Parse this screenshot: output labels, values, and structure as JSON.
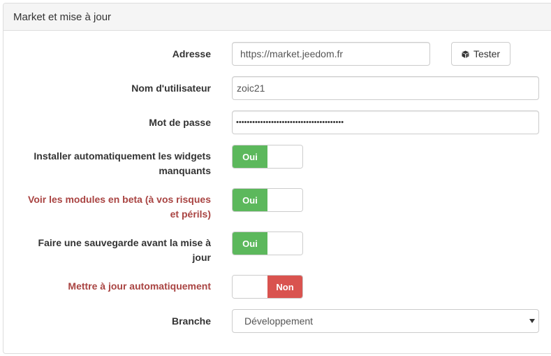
{
  "panel": {
    "title": "Market et mise à jour"
  },
  "fields": {
    "address": {
      "label": "Adresse",
      "value": "https://market.jeedom.fr"
    },
    "test_button": {
      "label": "Tester",
      "icon": "cube-icon"
    },
    "username": {
      "label": "Nom d'utilisateur",
      "value": "zoic21"
    },
    "password": {
      "label": "Mot de passe",
      "value": "••••••••••••••••••••••••••••••••••••••••"
    },
    "auto_widgets": {
      "label_line1": "Installer automatiquement les widgets",
      "label_line2": "manquants",
      "state": "Oui"
    },
    "beta_modules": {
      "label_line1": "Voir les modules en beta (à vos risques",
      "label_line2": "et périls)",
      "state": "Oui"
    },
    "backup_before_update": {
      "label_line1": "Faire une sauvegarde avant la mise à",
      "label_line2": "jour",
      "state": "Oui"
    },
    "auto_update": {
      "label": "Mettre à jour automatiquement",
      "state": "Non"
    },
    "branch": {
      "label": "Branche",
      "value": "Développement"
    }
  },
  "colors": {
    "on": "#5cb85c",
    "off": "#d9534f",
    "warning_label": "#a94442"
  }
}
